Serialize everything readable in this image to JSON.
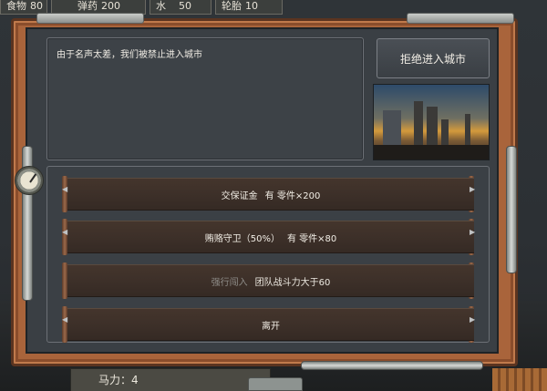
{
  "resources": [
    {
      "name": "食物",
      "value": "80"
    },
    {
      "name": "弹药",
      "value": "200"
    },
    {
      "name": "水",
      "value": "50"
    },
    {
      "name": "轮胎",
      "value": "10"
    }
  ],
  "event": {
    "message": "由于名声太差，我们被禁止进入城市",
    "refuse_label": "拒绝进入城市"
  },
  "options": [
    {
      "label": "交保证金",
      "cost": "有 零件×200",
      "enabled": true
    },
    {
      "label": "贿赂守卫（50%）",
      "cost": "有 零件×80",
      "enabled": true
    },
    {
      "label": "强行闯入",
      "cost": "团队战斗力大于60",
      "enabled": false
    },
    {
      "label": "离开",
      "cost": "",
      "enabled": true
    }
  ],
  "status": {
    "horsepower_label": "马力：4"
  }
}
